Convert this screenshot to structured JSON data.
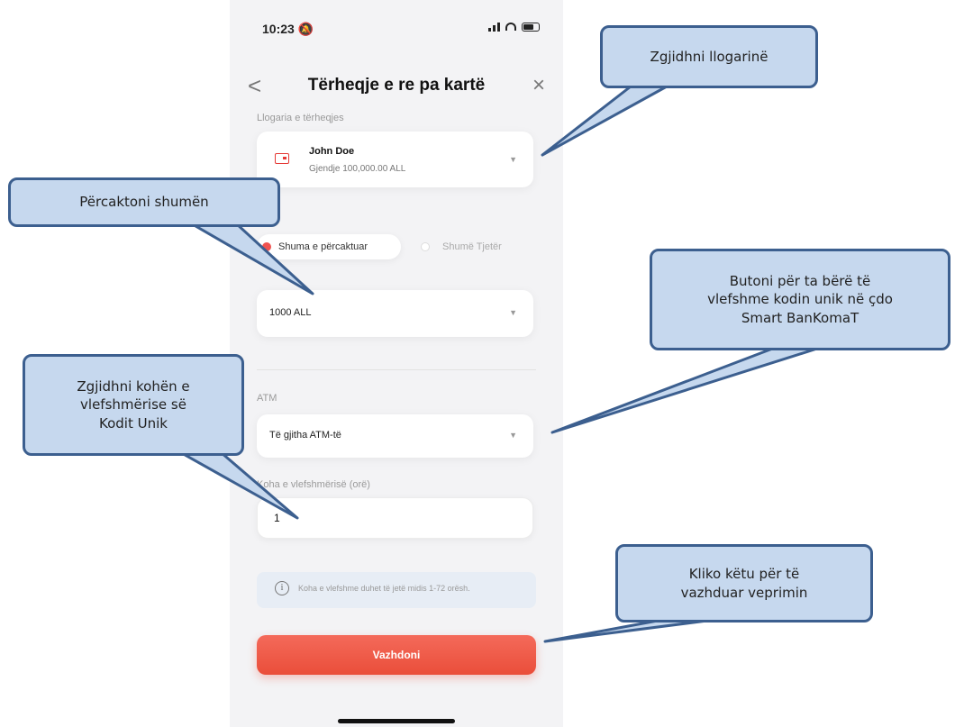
{
  "status_bar": {
    "time": "10:23 🔕"
  },
  "header": {
    "back": "<",
    "title": "Tërheqje e re pa kartë",
    "close": "×"
  },
  "account": {
    "label": "Llogaria e tërheqjes",
    "name": "John Doe",
    "balance": "Gjendje 100,000.00 ALL"
  },
  "amount_options": {
    "selected": "Shuma e përcaktuar",
    "other": "Shumë Tjetër"
  },
  "amount": {
    "value": "1000 ALL"
  },
  "atm": {
    "label": "ATM",
    "value": "Të gjitha ATM-të"
  },
  "validity": {
    "label": "Koha e vlefshmërisë (orë)",
    "value": "1"
  },
  "info": {
    "text": "Koha e vlefshme duhet të jetë midis 1-72 orësh."
  },
  "continue_label": "Vazhdoni",
  "callouts": {
    "account": "Zgjidhni llogarinë",
    "amount": "Përcaktoni shumën",
    "atm": "Butoni për ta bërë të\nvlefshme kodin unik në çdo\nSmart BanKomaT",
    "validity": "Zgjidhni kohën e\nvlefshmërise së\nKodit Unik",
    "continue": "Kliko këtu për të\nvazhduar veprimin"
  },
  "colors": {
    "accent": "#ea4e3a",
    "callout_fill": "#c6d8ee",
    "callout_border": "#3c5f8f"
  },
  "icons": [
    "back-icon",
    "close-icon",
    "account-icon",
    "chevron-down-icon",
    "info-icon"
  ]
}
